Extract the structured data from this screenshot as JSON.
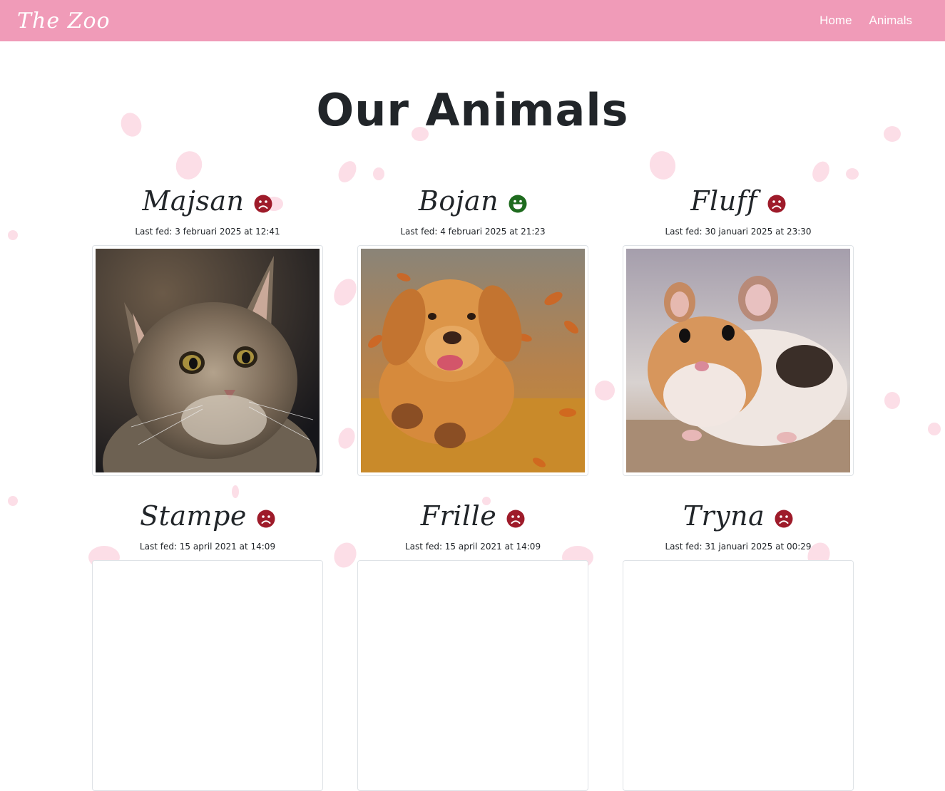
{
  "navbar": {
    "brand": "The Zoo",
    "links": [
      {
        "label": "Home"
      },
      {
        "label": "Animals"
      }
    ]
  },
  "page": {
    "title": "Our Animals"
  },
  "animals": [
    {
      "name": "Majsan",
      "last_fed": "Last fed: 3 februari 2025 at 12:41",
      "mood": "sad-face-icon"
    },
    {
      "name": "Bojan",
      "last_fed": "Last fed: 4 februari 2025 at 21:23",
      "mood": "happy-face-icon"
    },
    {
      "name": "Fluff",
      "last_fed": "Last fed: 30 januari 2025 at 23:30",
      "mood": "sad-face-icon"
    },
    {
      "name": "Stampe",
      "last_fed": "Last fed: 15 april 2021 at 14:09",
      "mood": "sad-face-icon"
    },
    {
      "name": "Frille",
      "last_fed": "Last fed: 15 april 2021 at 14:09",
      "mood": "sad-face-icon"
    },
    {
      "name": "Tryna",
      "last_fed": "Last fed: 31 januari 2025 at 00:29",
      "mood": "sad-face-icon"
    }
  ],
  "colors": {
    "navbar": "#f09bb8",
    "sad": "#9e1b2a",
    "happy": "#1e6b1e",
    "petal": "#fbd3df"
  }
}
